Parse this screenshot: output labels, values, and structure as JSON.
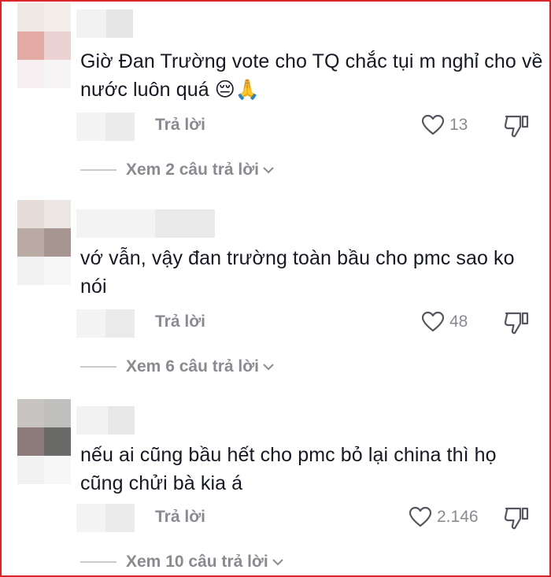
{
  "comments": [
    {
      "text": "Giờ Đan Trường vote cho TQ chắc tụi m nghỉ cho về nước luôn quá 😔🙏",
      "reply_label": "Trả lời",
      "likes": "13",
      "view_replies": "Xem 2 câu trả lời"
    },
    {
      "text": "vớ vẫn, vậy đan trường toàn bầu cho pmc sao ko nói",
      "reply_label": "Trả lời",
      "likes": "48",
      "view_replies": "Xem 6 câu trả lời"
    },
    {
      "text": "nếu ai cũng bầu hết cho pmc bỏ lại china thì họ cũng chửi bà kia á",
      "reply_label": "Trả lời",
      "likes": "2.146",
      "view_replies": "Xem 10 câu trả lời"
    }
  ],
  "icons": {
    "like": "heart-outline-icon",
    "dislike": "thumbs-down-icon",
    "expand": "chevron-down-icon"
  },
  "colors": {
    "text": "#161823",
    "muted": "#8a8b91",
    "frame_border": "#d9262b"
  }
}
